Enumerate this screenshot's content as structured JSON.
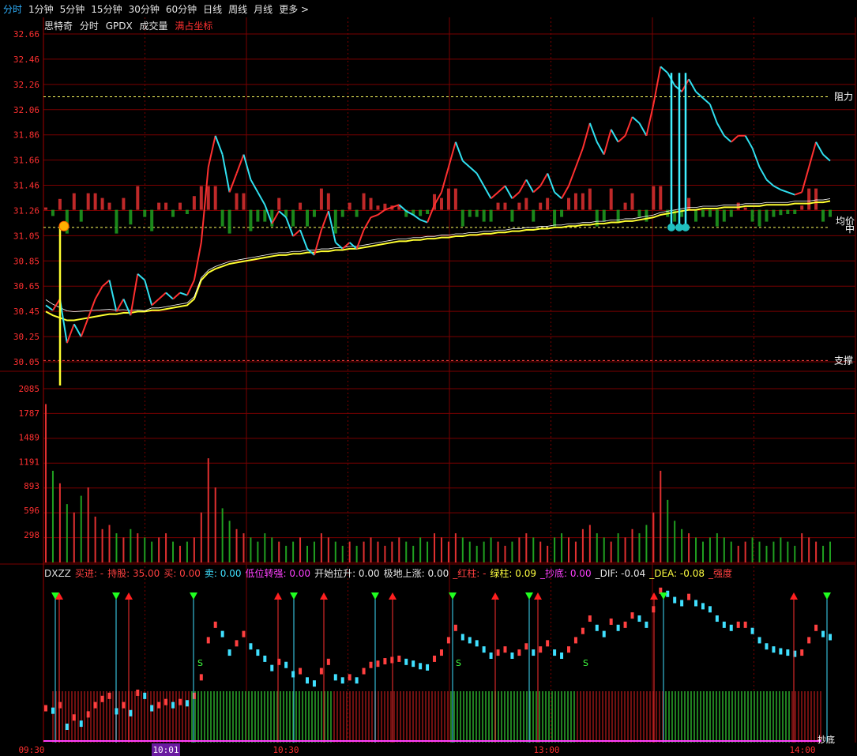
{
  "tabs": [
    {
      "label": "分时",
      "active": true
    },
    {
      "label": "1分钟"
    },
    {
      "label": "5分钟"
    },
    {
      "label": "15分钟"
    },
    {
      "label": "30分钟"
    },
    {
      "label": "60分钟"
    },
    {
      "label": "日线"
    },
    {
      "label": "周线"
    },
    {
      "label": "月线"
    },
    {
      "label": "更多 >"
    }
  ],
  "legend": {
    "stock": "思特奇",
    "mode": "分时",
    "gpdx": "GPDX",
    "volume": "成交量",
    "coord": "满占坐标"
  },
  "indicator_legend": [
    {
      "text": "DXZZ",
      "color": "#dddddd"
    },
    {
      "text": "买进: -",
      "color": "#ff4040"
    },
    {
      "text": "持股: 35.00",
      "color": "#ff4040"
    },
    {
      "text": "买: 0.00",
      "color": "#ff4040"
    },
    {
      "text": "卖: 0.00",
      "color": "#40e0ff"
    },
    {
      "text": "低位转强: 0.00",
      "color": "#ff40ff"
    },
    {
      "text": "开始拉升: 0.00",
      "color": "#e6e6e6"
    },
    {
      "text": "极地上涨: 0.00",
      "color": "#e6e6e6"
    },
    {
      "text": "_红柱: -",
      "color": "#ff4040"
    },
    {
      "text": "绿柱: 0.09",
      "color": "#ffff40"
    },
    {
      "text": "_抄底: 0.00",
      "color": "#ff40ff"
    },
    {
      "text": "_DIF: -0.04",
      "color": "#e6e6e6"
    },
    {
      "text": "_DEA: -0.08",
      "color": "#ffff40"
    },
    {
      "text": "_强度",
      "color": "#ff4040"
    }
  ],
  "colors": {
    "up": "#ff3030",
    "down": "#30e0f0",
    "avg": "#ffff30",
    "grid": "#7a0000",
    "bar_up": "#e03030",
    "bar_down": "#20a020"
  },
  "chart_data": {
    "type": "line",
    "price_axis": {
      "ticks": [
        "32.66",
        "32.46",
        "32.26",
        "32.06",
        "31.86",
        "31.66",
        "31.46",
        "31.26",
        "31.05",
        "30.85",
        "30.65",
        "30.45",
        "30.25",
        "30.05"
      ],
      "ylim": [
        30.05,
        32.66
      ]
    },
    "volume_axis": {
      "ticks": [
        "2085",
        "1787",
        "1489",
        "1191",
        "893",
        "596",
        "298"
      ],
      "ylim": [
        0,
        2085
      ]
    },
    "time_labels": [
      "09:30",
      "10:01",
      "10:30",
      "13:00",
      "14:00"
    ],
    "highlighted_time": "10:01",
    "level_labels": {
      "resistance": "阻力",
      "support": "支撑",
      "avg_price": "均价",
      "middle": "中"
    },
    "resistance_price": 32.16,
    "support_price": 30.06,
    "middle_price": 31.12,
    "indicator_labels": {
      "sell_mark": "S",
      "bottom_mark": "抄底"
    },
    "price_series": [
      30.5,
      30.46,
      30.55,
      30.2,
      30.35,
      30.25,
      30.4,
      30.55,
      30.65,
      30.7,
      30.45,
      30.55,
      30.42,
      30.75,
      30.7,
      30.5,
      30.55,
      30.6,
      30.55,
      30.6,
      30.58,
      30.7,
      31.0,
      31.6,
      31.85,
      31.7,
      31.4,
      31.55,
      31.7,
      31.5,
      31.4,
      31.3,
      31.15,
      31.25,
      31.2,
      31.05,
      31.1,
      30.95,
      30.9,
      31.1,
      31.25,
      31.0,
      30.95,
      31.0,
      30.95,
      31.1,
      31.2,
      31.22,
      31.26,
      31.28,
      31.3,
      31.25,
      31.22,
      31.18,
      31.16,
      31.3,
      31.4,
      31.6,
      31.8,
      31.65,
      31.6,
      31.55,
      31.45,
      31.35,
      31.4,
      31.45,
      31.35,
      31.4,
      31.5,
      31.4,
      31.45,
      31.55,
      31.4,
      31.35,
      31.45,
      31.6,
      31.75,
      31.95,
      31.8,
      31.7,
      31.9,
      31.8,
      31.85,
      32.0,
      31.95,
      31.85,
      32.1,
      32.4,
      32.35,
      32.25,
      32.2,
      32.3,
      32.2,
      32.15,
      32.1,
      31.95,
      31.85,
      31.8,
      31.85,
      31.85,
      31.75,
      31.6,
      31.5,
      31.45,
      31.42,
      31.4,
      31.38,
      31.4,
      31.6,
      31.8,
      31.7,
      31.65
    ],
    "avg_series": [
      30.45,
      30.42,
      30.4,
      30.38,
      30.38,
      30.39,
      30.4,
      30.41,
      30.42,
      30.43,
      30.43,
      30.44,
      30.44,
      30.45,
      30.45,
      30.46,
      30.46,
      30.47,
      30.48,
      30.49,
      30.5,
      30.55,
      30.7,
      30.76,
      30.79,
      30.81,
      30.83,
      30.84,
      30.85,
      30.86,
      30.87,
      30.88,
      30.89,
      30.9,
      30.9,
      30.91,
      30.91,
      30.92,
      30.92,
      30.93,
      30.93,
      30.94,
      30.94,
      30.95,
      30.95,
      30.96,
      30.97,
      30.98,
      30.99,
      31.0,
      31.01,
      31.01,
      31.02,
      31.02,
      31.03,
      31.03,
      31.04,
      31.04,
      31.05,
      31.05,
      31.06,
      31.06,
      31.07,
      31.07,
      31.08,
      31.08,
      31.09,
      31.09,
      31.1,
      31.1,
      31.11,
      31.11,
      31.12,
      31.12,
      31.13,
      31.13,
      31.14,
      31.14,
      31.15,
      31.15,
      31.16,
      31.16,
      31.17,
      31.17,
      31.18,
      31.19,
      31.2,
      31.22,
      31.23,
      31.24,
      31.25,
      31.26,
      31.26,
      31.27,
      31.27,
      31.27,
      31.28,
      31.28,
      31.28,
      31.29,
      31.29,
      31.29,
      31.3,
      31.3,
      31.3,
      31.3,
      31.31,
      31.31,
      31.31,
      31.32,
      31.32,
      31.33
    ],
    "volume_series": [
      1900,
      1100,
      950,
      700,
      600,
      800,
      900,
      550,
      400,
      450,
      350,
      300,
      400,
      350,
      300,
      250,
      300,
      350,
      250,
      200,
      250,
      300,
      600,
      1250,
      900,
      650,
      500,
      400,
      350,
      300,
      250,
      350,
      300,
      250,
      200,
      250,
      300,
      200,
      250,
      350,
      300,
      250,
      200,
      250,
      200,
      250,
      300,
      250,
      200,
      250,
      300,
      250,
      200,
      300,
      250,
      350,
      300,
      250,
      350,
      300,
      250,
      200,
      250,
      300,
      250,
      200,
      250,
      300,
      350,
      300,
      250,
      200,
      300,
      350,
      300,
      250,
      400,
      450,
      350,
      300,
      250,
      350,
      300,
      400,
      350,
      450,
      600,
      1100,
      750,
      500,
      400,
      350,
      300,
      250,
      300,
      350,
      300,
      250,
      200,
      250,
      300,
      250,
      200,
      250,
      300,
      250,
      200,
      350,
      300,
      250,
      200,
      250
    ]
  }
}
